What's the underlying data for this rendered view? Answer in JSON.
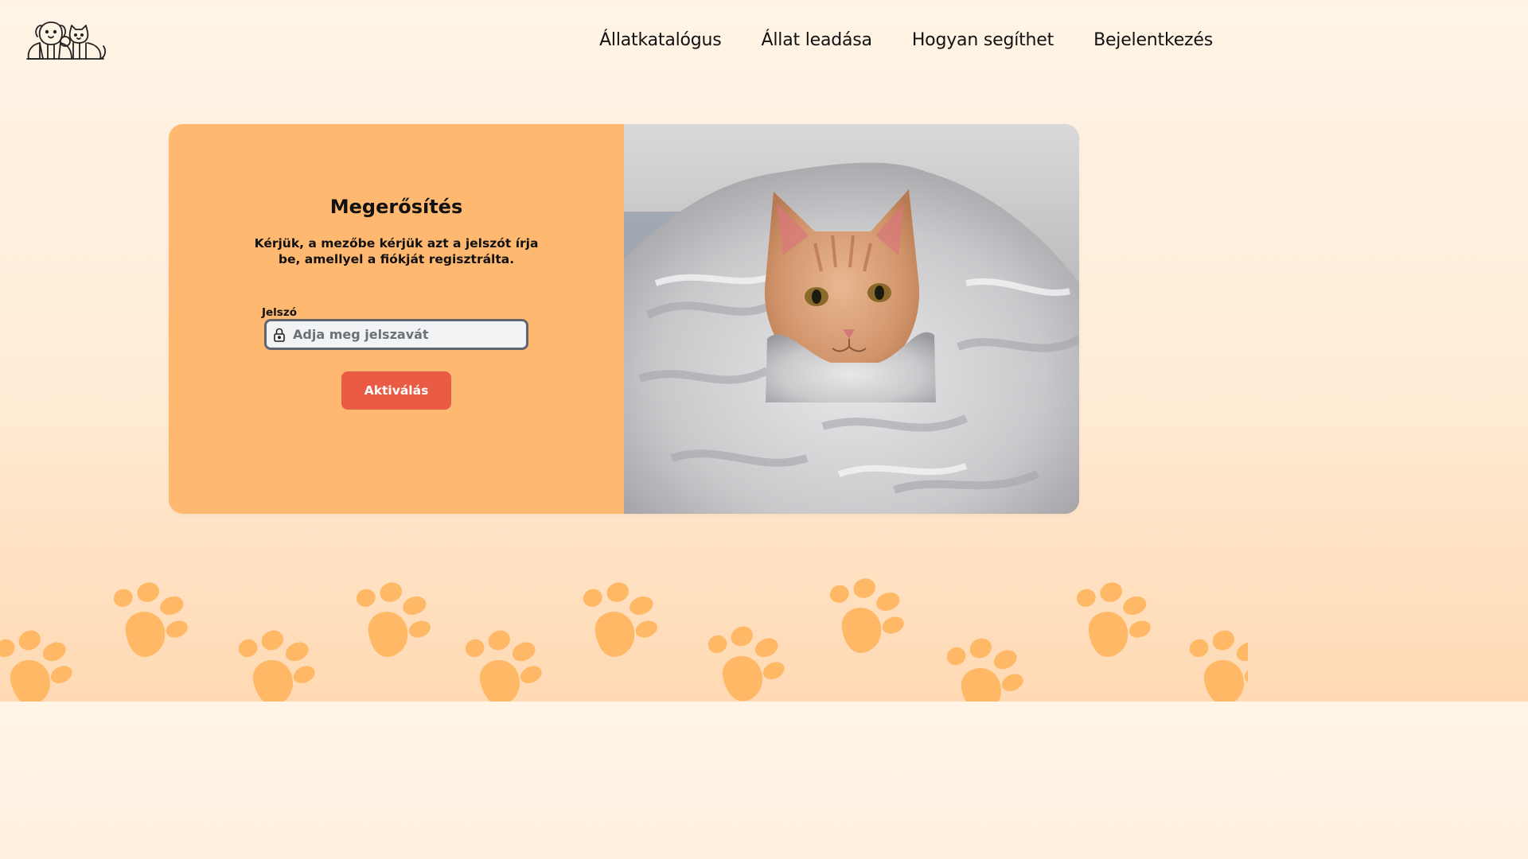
{
  "header": {
    "logo_name": "dog-and-cat-logo",
    "nav": [
      {
        "label": "Állatkatalógus"
      },
      {
        "label": "Állat leadása"
      },
      {
        "label": "Hogyan segíthet"
      },
      {
        "label": "Bejelentkezés"
      }
    ]
  },
  "form": {
    "title": "Megerősítés",
    "description": "Kérjük, a mezőbe kérjük azt a jelszót írja be, amellyel a fiókját regisztrálta.",
    "password_label": "Jelszó",
    "password_placeholder": "Adja meg jelszavát",
    "password_value": "",
    "submit_label": "Aktiválás"
  },
  "image": {
    "subject": "orange tabby cat wrapped in a grey blanket"
  },
  "colors": {
    "card_left": "#ffb870",
    "button": "#e95b45",
    "paws": "#ffb866"
  }
}
